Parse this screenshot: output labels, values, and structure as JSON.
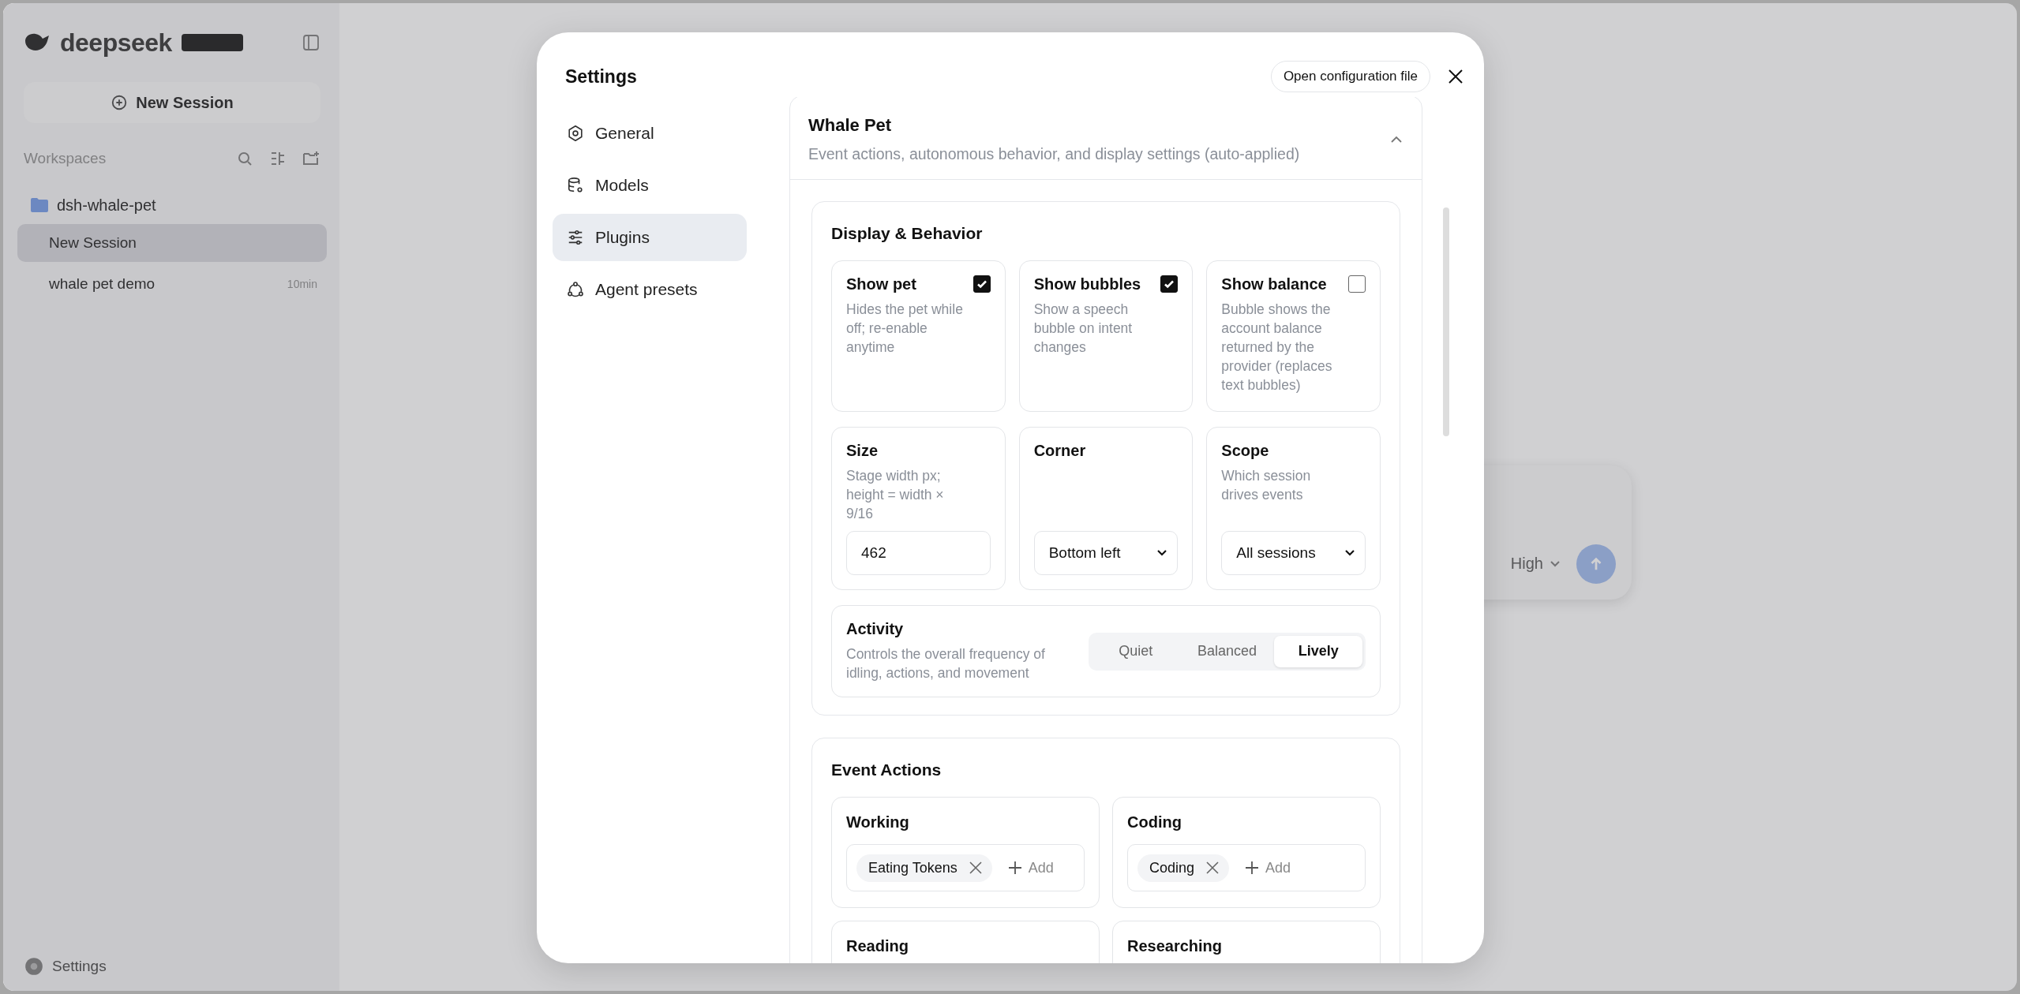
{
  "app": {
    "logo": "deepseek",
    "new_session": "New Session",
    "workspaces_label": "Workspaces",
    "workspace": {
      "name": "dsh-whale-pet",
      "sessions": [
        {
          "title": "New Session",
          "selected": true
        },
        {
          "title": "whale pet demo",
          "time": "10min",
          "selected": false
        }
      ]
    },
    "settings": "Settings",
    "composer": {
      "effort": "High"
    }
  },
  "dialog": {
    "title": "Settings",
    "open_config": "Open configuration file",
    "nav": [
      {
        "label": "General",
        "selected": false
      },
      {
        "label": "Models",
        "selected": false
      },
      {
        "label": "Plugins",
        "selected": true
      },
      {
        "label": "Agent presets",
        "selected": false
      }
    ],
    "plugin": {
      "title": "Whale Pet",
      "subtitle": "Event actions, autonomous behavior, and display settings (auto-applied)",
      "expanded": true,
      "display": {
        "title": "Display & Behavior",
        "toggles": [
          {
            "label": "Show pet",
            "description": "Hides the pet while off; re-enable anytime",
            "checked": true
          },
          {
            "label": "Show bubbles",
            "description": "Show a speech bubble on intent changes",
            "checked": true
          },
          {
            "label": "Show balance",
            "description": "Bubble shows the account balance returned by the provider (replaces text bubbles)",
            "checked": false
          }
        ],
        "fields": [
          {
            "kind": "number",
            "label": "Size",
            "description": "Stage width px; height = width × 9/16",
            "value": "462"
          },
          {
            "kind": "select",
            "label": "Corner",
            "value": "Bottom left"
          },
          {
            "kind": "select",
            "label": "Scope",
            "description": "Which session drives events",
            "value": "All sessions"
          }
        ],
        "activity": {
          "label": "Activity",
          "description": "Controls the overall frequency of idling, actions, and movement",
          "options": [
            {
              "label": "Quiet",
              "selected": false
            },
            {
              "label": "Balanced",
              "selected": false
            },
            {
              "label": "Lively",
              "selected": true
            }
          ]
        }
      },
      "events": {
        "title": "Event Actions",
        "items": [
          {
            "label": "Working",
            "actions": [
              "Eating Tokens"
            ],
            "add": "Add"
          },
          {
            "label": "Coding",
            "actions": [
              "Coding"
            ],
            "add": "Add"
          },
          {
            "label": "Reading"
          },
          {
            "label": "Researching"
          }
        ]
      }
    }
  }
}
